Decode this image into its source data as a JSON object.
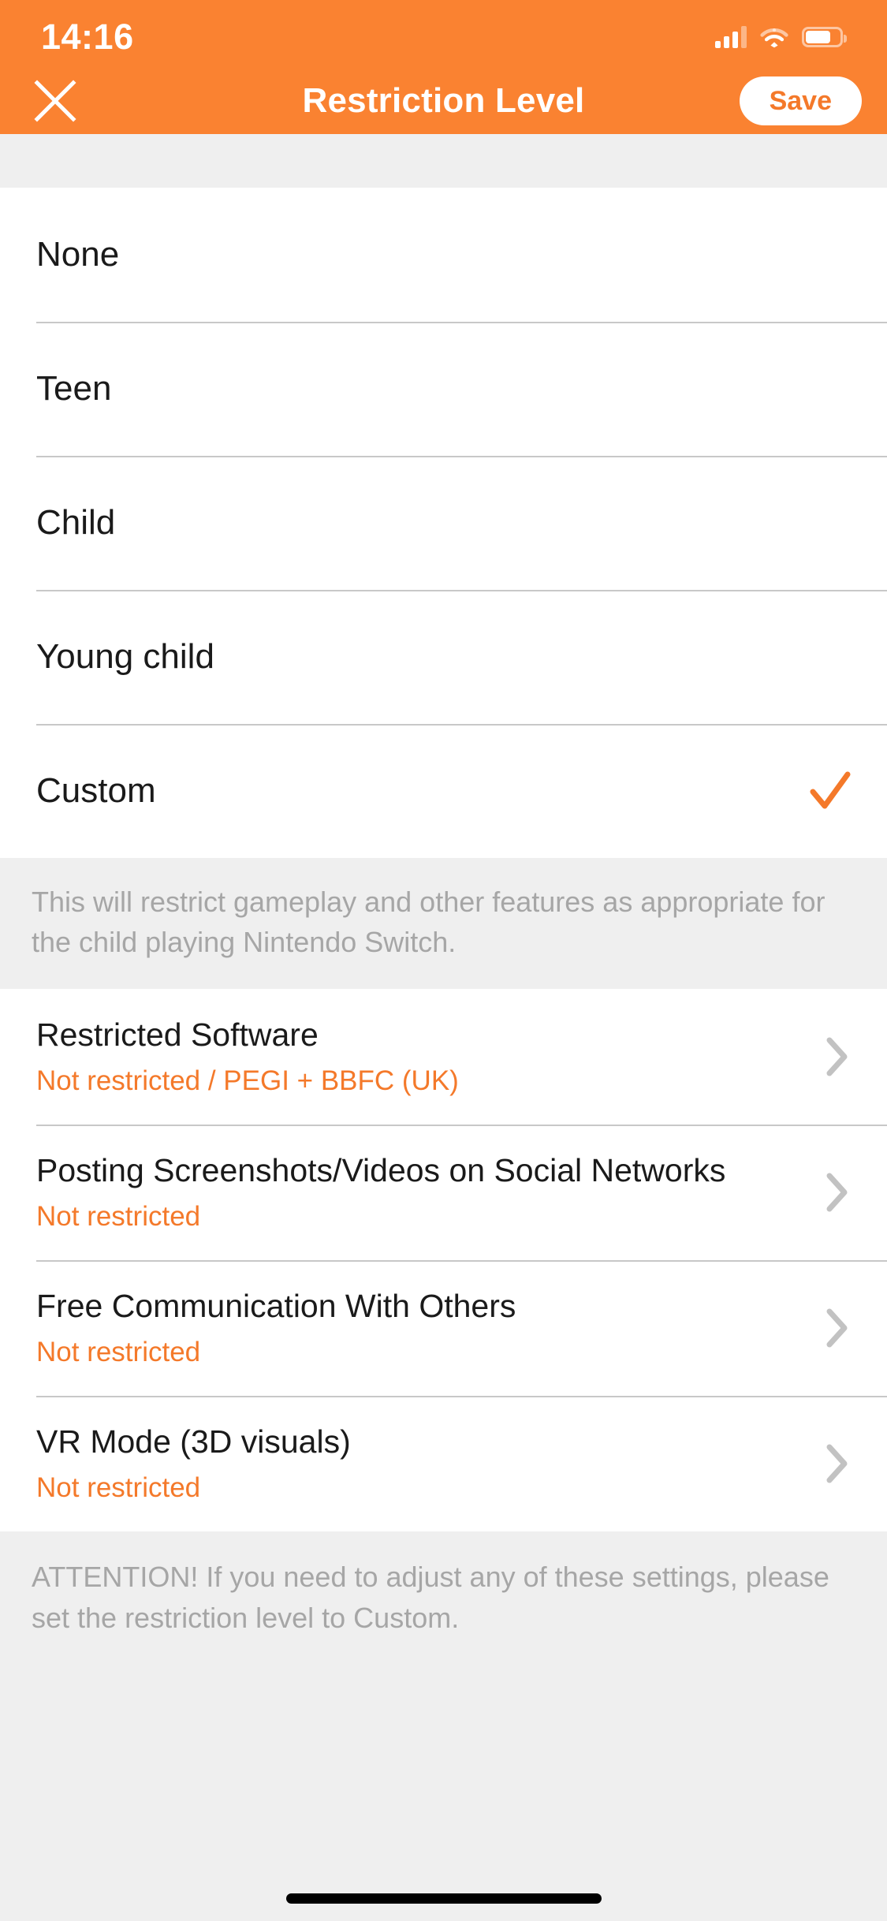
{
  "status_bar": {
    "time": "14:16",
    "cellular_icon": "signal-bars-icon",
    "cellular_bars_filled": 3,
    "cellular_bars_total": 4,
    "wifi_icon": "wifi-icon",
    "battery_icon": "battery-icon",
    "battery_level_percent": 68
  },
  "nav_bar": {
    "close_icon": "close-icon",
    "title": "Restriction Level",
    "save_label": "Save"
  },
  "restriction_levels": {
    "options": [
      {
        "label": "None",
        "selected": false
      },
      {
        "label": "Teen",
        "selected": false
      },
      {
        "label": "Child",
        "selected": false
      },
      {
        "label": "Young child",
        "selected": false
      },
      {
        "label": "Custom",
        "selected": true
      }
    ],
    "checkmark_icon": "checkmark-icon",
    "description": "This will restrict gameplay and other features as appropriate for the child playing Nintendo Switch."
  },
  "settings": {
    "rows": [
      {
        "title": "Restricted Software",
        "value": "Not restricted / PEGI + BBFC (UK)",
        "chevron_icon": "chevron-right-icon"
      },
      {
        "title": "Posting Screenshots/Videos on Social Networks",
        "value": "Not restricted",
        "chevron_icon": "chevron-right-icon"
      },
      {
        "title": "Free Communication With Others",
        "value": "Not restricted",
        "chevron_icon": "chevron-right-icon"
      },
      {
        "title": "VR Mode (3D visuals)",
        "value": "Not restricted",
        "chevron_icon": "chevron-right-icon"
      }
    ],
    "footer_note": "ATTENTION! If you need to adjust any of these settings, please set the restriction level to Custom."
  },
  "colors": {
    "accent_orange": "#FA8231",
    "value_orange": "#F4792A",
    "background_gray": "#EFEFEF",
    "card_white": "#FFFFFF",
    "muted_text": "#A6A6A6",
    "primary_text": "#1A1A1A",
    "divider": "#C8C8C8"
  },
  "home_indicator": "home-indicator"
}
